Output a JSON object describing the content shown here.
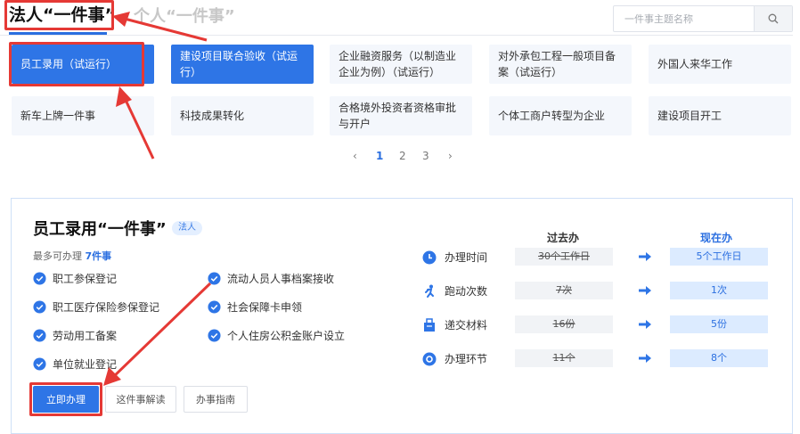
{
  "tabs": {
    "active": "法人“一件事”",
    "inactive": "个人“一件事”"
  },
  "search": {
    "placeholder": "一件事主题名称"
  },
  "grid": {
    "items": [
      {
        "label": "员工录用（试运行）"
      },
      {
        "label": "建设项目联合验收（试运行）"
      },
      {
        "label": "企业融资服务（以制造业企业为例）（试运行）"
      },
      {
        "label": "对外承包工程一般项目备案（试运行）"
      },
      {
        "label": "外国人来华工作"
      },
      {
        "label": "新车上牌一件事"
      },
      {
        "label": "科技成果转化"
      },
      {
        "label": "合格境外投资者资格审批与开户"
      },
      {
        "label": "个体工商户转型为企业"
      },
      {
        "label": "建设项目开工"
      }
    ]
  },
  "pagination": {
    "prev": "‹",
    "pages": [
      "1",
      "2",
      "3"
    ],
    "next": "›"
  },
  "detail": {
    "title": "员工录用“一件事”",
    "tag": "法人",
    "max_prefix": "最多可办理",
    "max_count": "7件事",
    "checklist": [
      "职工参保登记",
      "职工医疗保险参保登记",
      "劳动用工备案",
      "单位就业登记",
      "流动人员人事档案接收",
      "社会保障卡申领",
      "个人住房公积金账户设立"
    ],
    "buttons": {
      "apply": "立即办理",
      "explain": "这件事解读",
      "guide": "办事指南"
    },
    "compare": {
      "past_label": "过去办",
      "now_label": "现在办",
      "rows": [
        {
          "label": "办理时间",
          "icon": "clock-icon",
          "past": "30个工作日",
          "now": "5个工作日"
        },
        {
          "label": "跑动次数",
          "icon": "running-icon",
          "past": "7次",
          "now": "1次"
        },
        {
          "label": "递交材料",
          "icon": "documents-icon",
          "past": "16份",
          "now": "5份"
        },
        {
          "label": "办理环节",
          "icon": "steps-icon",
          "past": "11个",
          "now": "8个"
        }
      ]
    }
  },
  "colors": {
    "accent": "#2e75e6",
    "annotation": "#e53935"
  }
}
